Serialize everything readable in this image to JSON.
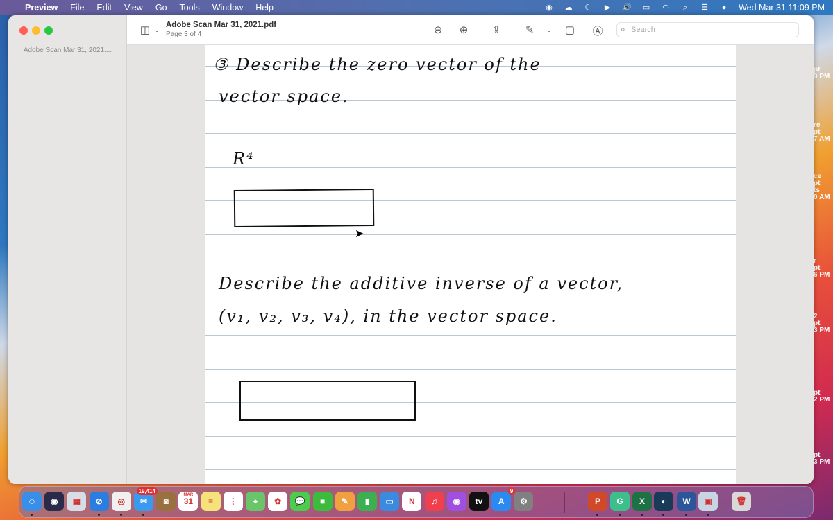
{
  "menubar": {
    "app": "Preview",
    "items": [
      "File",
      "Edit",
      "View",
      "Go",
      "Tools",
      "Window",
      "Help"
    ],
    "clock": "Wed Mar 31  11:09 PM"
  },
  "desktop_labels": [
    [
      "pt",
      "9 PM"
    ],
    [
      "re",
      "pt",
      "7 AM"
    ],
    [
      "ce",
      "pt",
      "ts",
      "0 AM"
    ],
    [
      "r",
      "pt",
      "6 PM"
    ],
    [
      "2",
      "pt",
      "3 PM"
    ],
    [
      "pt",
      "2 PM"
    ],
    [
      "pt",
      "3 PM"
    ]
  ],
  "window": {
    "title": "Adobe Scan Mar 31, 2021.pdf",
    "subtitle": "Page 3 of 4",
    "sidebar_thumb_label": "Adobe Scan Mar 31, 2021....",
    "search_placeholder": "Search"
  },
  "document": {
    "q1_line1": "③ Describe  the  zero  vector  of  the",
    "q1_line2": "vector  space.",
    "q1_space": "R⁴",
    "q2_line1": "Describe  the  additive  inverse  of a  vector,",
    "q2_line2": "(v₁, v₂, v₃, v₄),  in  the  vector  space."
  },
  "dock": {
    "apps": [
      {
        "name": "finder",
        "color": "#3a8ee8",
        "glyph": "☺",
        "running": true
      },
      {
        "name": "siri",
        "color": "#2a2a4a",
        "glyph": "◉"
      },
      {
        "name": "launchpad",
        "color": "#d8dce4",
        "glyph": "▦"
      },
      {
        "name": "safari",
        "color": "#2a7ee0",
        "glyph": "⊘",
        "running": true
      },
      {
        "name": "chrome",
        "color": "#f0f0f0",
        "glyph": "◎",
        "running": true
      },
      {
        "name": "mail",
        "color": "#3a9af0",
        "glyph": "✉",
        "badge": "19,414",
        "running": true
      },
      {
        "name": "contacts",
        "color": "#9a7040",
        "glyph": "◙"
      },
      {
        "name": "calendar",
        "color": "#ffffff",
        "glyph": "31",
        "label": "MAR"
      },
      {
        "name": "notes",
        "color": "#f6e27a",
        "glyph": "≡"
      },
      {
        "name": "reminders",
        "color": "#ffffff",
        "glyph": "⋮"
      },
      {
        "name": "maps",
        "color": "#6ac46a",
        "glyph": "⌖"
      },
      {
        "name": "photos",
        "color": "#ffffff",
        "glyph": "✿"
      },
      {
        "name": "messages",
        "color": "#4ccb4c",
        "glyph": "💬"
      },
      {
        "name": "facetime",
        "color": "#3cbb3c",
        "glyph": "■"
      },
      {
        "name": "pages",
        "color": "#f0a040",
        "glyph": "✎"
      },
      {
        "name": "numbers",
        "color": "#3cb050",
        "glyph": "▮"
      },
      {
        "name": "keynote",
        "color": "#3a8ae0",
        "glyph": "▭"
      },
      {
        "name": "news",
        "color": "#ffffff",
        "glyph": "N"
      },
      {
        "name": "music",
        "color": "#f04050",
        "glyph": "♫"
      },
      {
        "name": "podcasts",
        "color": "#a050e0",
        "glyph": "◉"
      },
      {
        "name": "apple-tv",
        "color": "#111111",
        "glyph": "tv"
      },
      {
        "name": "app-store",
        "color": "#2a8af0",
        "glyph": "A",
        "badge": "9"
      },
      {
        "name": "system-preferences",
        "color": "#808080",
        "glyph": "⚙"
      },
      {
        "name": "powerpoint",
        "color": "#d04a2a",
        "glyph": "P",
        "running": true
      },
      {
        "name": "grammarly",
        "color": "#3cbf8a",
        "glyph": "G",
        "running": true
      },
      {
        "name": "excel",
        "color": "#1e7145",
        "glyph": "X",
        "running": true
      },
      {
        "name": "webex",
        "color": "#1a3a5a",
        "glyph": "◐",
        "running": true
      },
      {
        "name": "word",
        "color": "#2b579a",
        "glyph": "W",
        "running": true
      },
      {
        "name": "preview",
        "color": "#c8d4e4",
        "glyph": "▣",
        "running": true
      },
      {
        "name": "trash",
        "color": "#d8d8d8",
        "glyph": "🗑"
      }
    ]
  }
}
